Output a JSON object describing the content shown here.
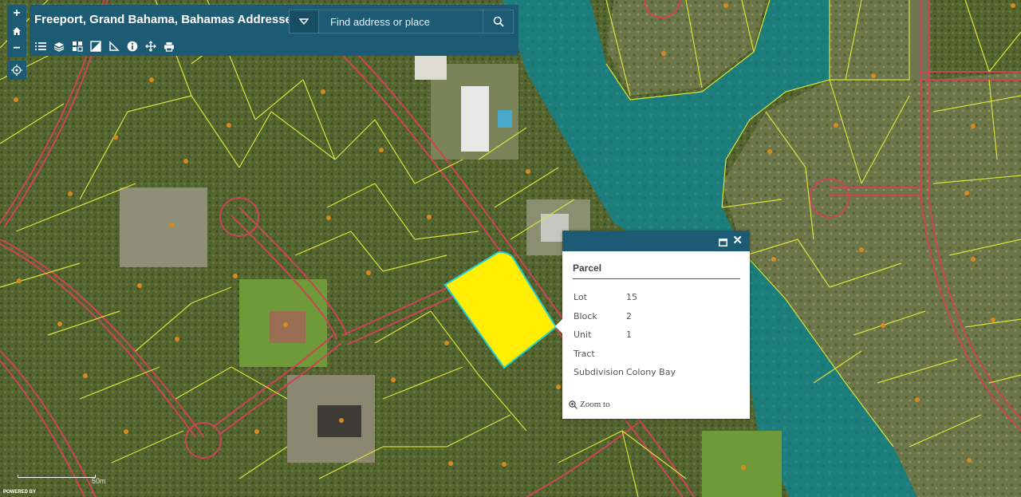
{
  "header": {
    "title": "Freeport, Grand Bahama, Bahamas Addresses",
    "search_placeholder": "Find address or place"
  },
  "zoom": {
    "in_label": "+",
    "out_label": "−"
  },
  "toolbar": [
    "list-icon",
    "layers-icon",
    "basemap-icon",
    "legend-icon",
    "measure-icon",
    "info-icon",
    "share-icon",
    "print-icon"
  ],
  "popup": {
    "title": "Parcel",
    "fields": [
      {
        "key": "Lot",
        "value": "15"
      },
      {
        "key": "Block",
        "value": "2"
      },
      {
        "key": "Unit",
        "value": "1"
      },
      {
        "key": "Tract",
        "value": ""
      },
      {
        "key": "Subdivision",
        "value": "Colony Bay"
      }
    ],
    "zoom_to_label": "Zoom to"
  },
  "scale_label": "50m",
  "powered_by": "POWERED BY",
  "colors": {
    "accent": "#1d5a73",
    "parcel_highlight": "#ffee00",
    "parcel_outline": "#22d0d0",
    "parcel_lines": "#d9e23a",
    "roads": "#cc4455",
    "water": "#1e7f7a"
  }
}
